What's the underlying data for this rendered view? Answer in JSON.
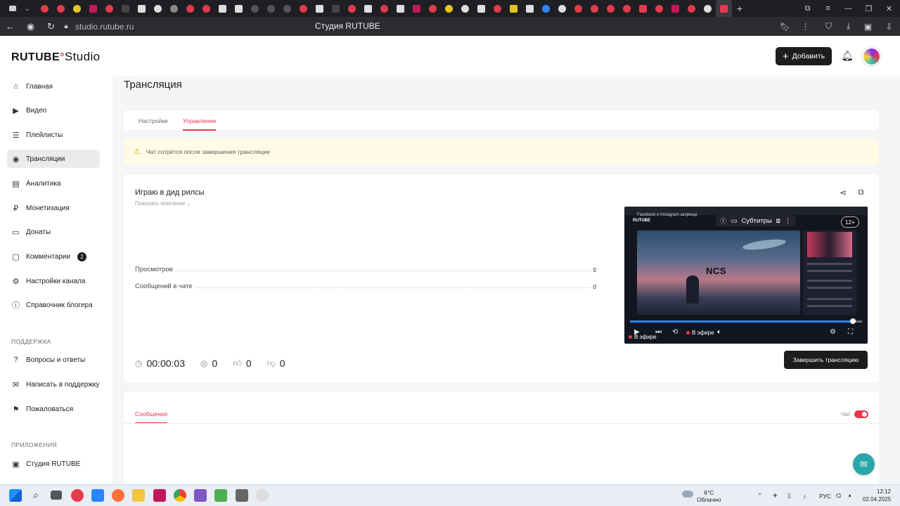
{
  "browser": {
    "url": "studio.rutube.ru",
    "page_title": "Студия RUTUBE"
  },
  "header": {
    "logo_main": "RUTUBE",
    "logo_studio": "Studio",
    "add_label": "Добавить"
  },
  "sidebar": {
    "items": [
      {
        "label": "Главная",
        "icon": "home-icon"
      },
      {
        "label": "Видео",
        "icon": "video-icon"
      },
      {
        "label": "Плейлисты",
        "icon": "playlist-icon"
      },
      {
        "label": "Трансляции",
        "icon": "broadcast-icon"
      },
      {
        "label": "Аналитика",
        "icon": "analytics-icon"
      },
      {
        "label": "Монетизация",
        "icon": "monetization-icon"
      },
      {
        "label": "Донаты",
        "icon": "donations-icon"
      },
      {
        "label": "Комментарии",
        "icon": "comments-icon",
        "badge": "2"
      },
      {
        "label": "Настройки канала",
        "icon": "settings-icon"
      },
      {
        "label": "Справочник блогера",
        "icon": "info-icon"
      }
    ],
    "support_title": "ПОДДЕРЖКА",
    "support_items": [
      {
        "label": "Вопросы и ответы",
        "icon": "faq-icon"
      },
      {
        "label": "Написать в поддержку",
        "icon": "mail-icon"
      },
      {
        "label": "Пожаловаться",
        "icon": "flag-icon"
      }
    ],
    "apps_title": "ПРИЛОЖЕНИЯ",
    "apps_items": [
      {
        "label": "Студия RUTUBE",
        "icon": "studio-app-icon"
      }
    ]
  },
  "main": {
    "page_title": "Трансляция",
    "tabs": [
      {
        "label": "Настройки"
      },
      {
        "label": "Управление"
      }
    ],
    "warning": "Чат сотрётся после завершения трансляции",
    "stream": {
      "title": "Играю в дид рилсы",
      "show_description": "Показать описание",
      "stats": [
        {
          "label": "Просмотров",
          "value": "0"
        },
        {
          "label": "Сообщений в чате",
          "value": "0"
        }
      ],
      "duration": "00:00:03",
      "viewers": "0",
      "likes": "0",
      "dislikes": "0",
      "end_label": "Завершить трансляцию"
    },
    "player": {
      "subtitles": "Субтитры",
      "age": "12+",
      "live_label": "В эфире",
      "live_label_2": "В эфире",
      "page_caption": "Facebook и Instagram запреще",
      "logo": "RUTUBE",
      "artwork_text": "NCS",
      "progress": 0.96
    },
    "messages": {
      "tab_label": "Сообщения",
      "chat_label": "Чат",
      "chat_enabled": true
    }
  },
  "taskbar": {
    "weather": "6°C",
    "weather_desc": "Облачно",
    "lang": "РУС",
    "time": "12:12",
    "date": "02.04.2025"
  },
  "colors": {
    "accent": "#e8384f",
    "dark_button": "#1d1d1f",
    "warning_bg": "#fffbe6",
    "help_fab": "#2ba6a8"
  }
}
